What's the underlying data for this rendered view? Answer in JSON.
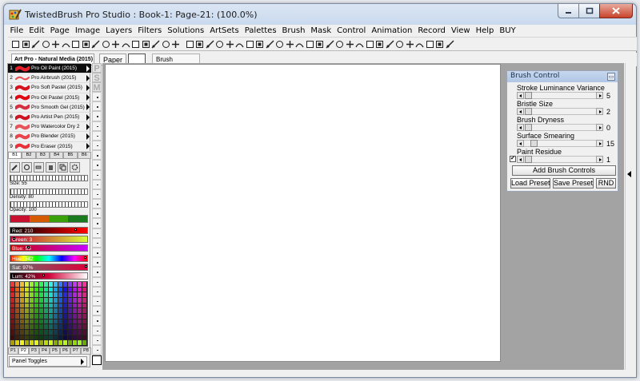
{
  "window": {
    "title": "TwistedBrush Pro Studio : Book-1: Page-21:  (100.0%)"
  },
  "menu": [
    "File",
    "Edit",
    "Page",
    "Image",
    "Layers",
    "Filters",
    "Solutions",
    "ArtSets",
    "Palettes",
    "Brush",
    "Mask",
    "Control",
    "Animation",
    "Record",
    "View",
    "Help",
    "BUY"
  ],
  "subbar": {
    "preset_collection": "Art Pro - Natural Media (2015)",
    "paper_label": "Paper",
    "brush_label": "Brush"
  },
  "brushes": [
    {
      "num": "1",
      "name": "Pro Oil Paint (2015)",
      "color": "#e8202a",
      "selected": true
    },
    {
      "num": "2",
      "name": "Pro Airbrush (2015)",
      "color": "#e84d53"
    },
    {
      "num": "3",
      "name": "Pro Soft Pastel (2015)",
      "color": "#d8121c"
    },
    {
      "num": "4",
      "name": "Pro Oil Pastel (2015)",
      "color": "#e00812"
    },
    {
      "num": "5",
      "name": "Pro Smooth Gel (2015)",
      "color": "#d63042"
    },
    {
      "num": "6",
      "name": "Pro Artist Pen (2015)",
      "color": "#cc1622"
    },
    {
      "num": "7",
      "name": "Pro Watercolor Dry 2",
      "color": "#e7545b"
    },
    {
      "num": "8",
      "name": "Pro Blender (2015)",
      "color": "#e8454c"
    },
    {
      "num": "9",
      "name": "Pro Eraser (2015)",
      "color": "#e8313a"
    }
  ],
  "brush_banks": [
    "B1",
    "B2",
    "B3",
    "B4",
    "B5",
    "B6"
  ],
  "side_letters": [
    "P",
    "S",
    "M"
  ],
  "sliders": {
    "size": "Size: 55",
    "density": "Density: 80",
    "opacity": "Opacity: 100"
  },
  "color_swatches": [
    "#c8102e",
    "#d45b00",
    "#3aa10a",
    "#197a1f"
  ],
  "colors": {
    "red": "Red: 210",
    "green": "Green: 3",
    "blue": "Blue: 55",
    "hue": "Hue: 342",
    "sat": "Sat: 97%",
    "lum": "Lum: 42%"
  },
  "palette_tabs": [
    "P1",
    "P2",
    "P3",
    "P4",
    "P5",
    "P6",
    "P7",
    "P8"
  ],
  "panel_toggles": "Panel Toggles",
  "brush_control": {
    "title": "Brush Control",
    "params": [
      {
        "label": "Stroke Luminance Variance",
        "value": "5"
      },
      {
        "label": "Bristle Size",
        "value": "2"
      },
      {
        "label": "Brush Dryness",
        "value": "0"
      },
      {
        "label": "Surface Smearing",
        "value": "15"
      },
      {
        "label": "Paint Residue",
        "value": "1"
      }
    ],
    "add_button": "Add Brush Controls",
    "load_button": "Load Preset",
    "save_button": "Save Preset",
    "rnd_button": "RND"
  }
}
